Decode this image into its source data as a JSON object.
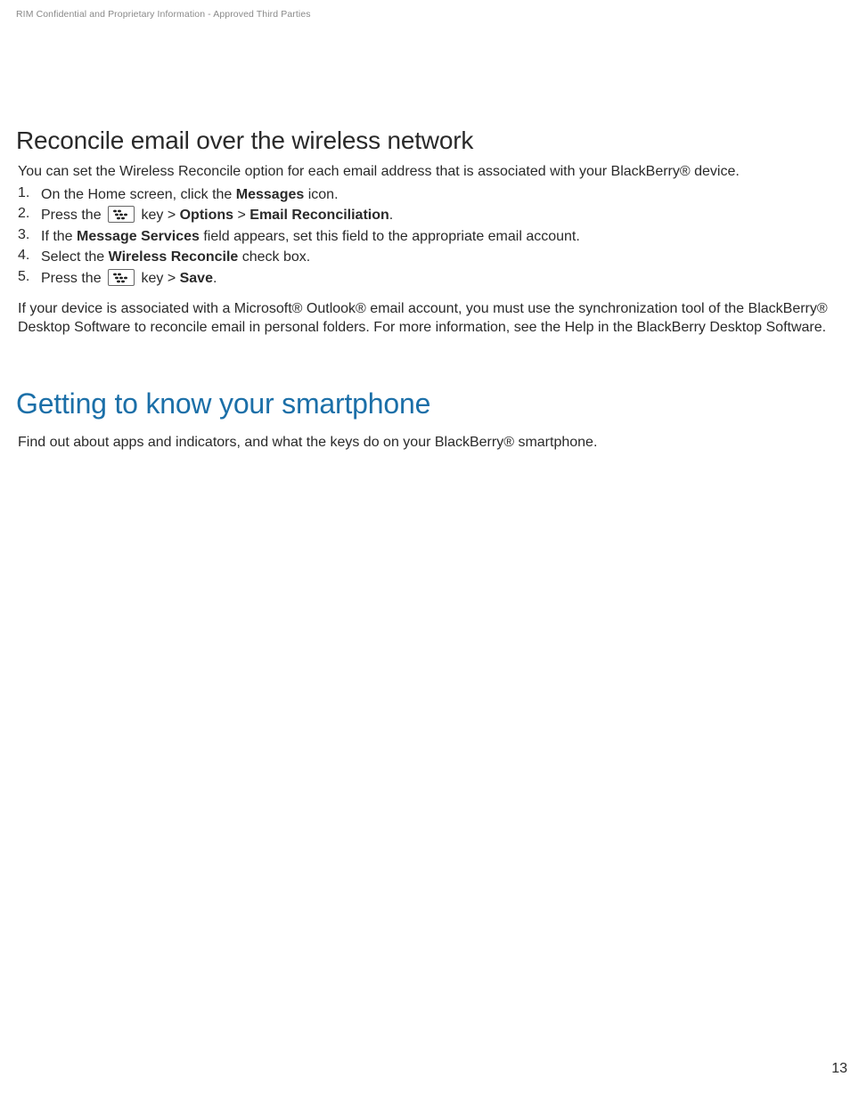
{
  "header": {
    "confidential": "RIM Confidential and Proprietary Information - Approved Third Parties"
  },
  "section1": {
    "heading": "Reconcile email over the wireless network",
    "intro": "You can set the Wireless Reconcile option for each email address that is associated with your BlackBerry® device.",
    "steps": [
      {
        "n": "1.",
        "pre": "On the Home screen, click the ",
        "bold1": "Messages",
        "post": " icon."
      },
      {
        "n": "2.",
        "pre": "Press the ",
        "key": true,
        "mid": " key > ",
        "bold1": "Options",
        "sep": " > ",
        "bold2": "Email Reconciliation",
        "post": "."
      },
      {
        "n": "3.",
        "pre": "If the ",
        "bold1": "Message Services",
        "post": " field appears, set this field to the appropriate email account."
      },
      {
        "n": "4.",
        "pre": "Select the ",
        "bold1": "Wireless Reconcile",
        "post": " check box."
      },
      {
        "n": "5.",
        "pre": "Press the ",
        "key": true,
        "mid": " key > ",
        "bold1": "Save",
        "post": "."
      }
    ],
    "footer_para": "If your device is associated with a Microsoft® Outlook® email account, you must use the synchronization tool of the BlackBerry® Desktop Software to reconcile email in personal folders. For more information, see the Help in the BlackBerry Desktop Software."
  },
  "section2": {
    "heading": "Getting to know your smartphone",
    "intro": "Find out about apps and indicators, and what the keys do on your BlackBerry® smartphone."
  },
  "page_number": "13"
}
